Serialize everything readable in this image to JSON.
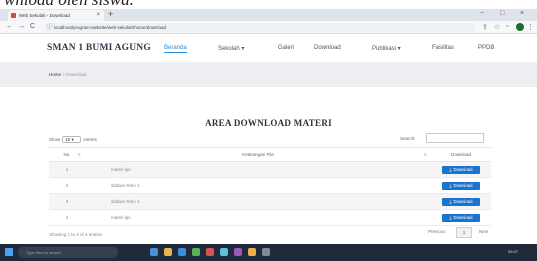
{
  "doc_caption": "wnload oleh siswa.",
  "browser": {
    "tab_title": "Web Sekolah - Download",
    "tab_close": "×",
    "new_tab": "+",
    "url": "localhost/program-website/web-sekolah/home/download",
    "back": "←",
    "forward": "→",
    "reload": "C",
    "win_min": "−",
    "win_max": "□",
    "win_close": "×"
  },
  "site": {
    "brand": "SMAN 1 BUMI AGUNG",
    "nav": {
      "beranda": "Beranda",
      "sekolah": "Sekolah ▾",
      "galeri": "Galeri",
      "download": "Download",
      "publikasi": "Publikasi ▾",
      "fasilitas": "Fasilitas",
      "ppdb": "PPDB"
    }
  },
  "breadcrumb": {
    "home": "Home",
    "sep": " > ",
    "current": "Download"
  },
  "section_title": "AREA DOWNLOAD MATERI",
  "table_controls": {
    "show_label": "Show",
    "entries_value": "10 ▾",
    "entries_label": "entries",
    "search_label": "Search:"
  },
  "table": {
    "headers": {
      "no": "No.",
      "ket": "Keterangan File",
      "dl": "Download"
    },
    "download_label": "Download",
    "rows": [
      {
        "no": "1",
        "ket": "materi ips"
      },
      {
        "no": "2",
        "ket": "sbdavs Rolo 1"
      },
      {
        "no": "3",
        "ket": "sbdavs Rolo 1"
      },
      {
        "no": "4",
        "ket": "materi ips"
      }
    ]
  },
  "footer": {
    "info": "Showing 1 to 4 of 4 entries",
    "previous": "Previous",
    "current_page": "1",
    "next": "Next"
  },
  "taskbar": {
    "search_placeholder": "Type here to search",
    "time": "09:47"
  },
  "colors": {
    "accent": "#2d8bd6",
    "download_button": "#1b73d1",
    "taskbar": "#202a3a"
  }
}
